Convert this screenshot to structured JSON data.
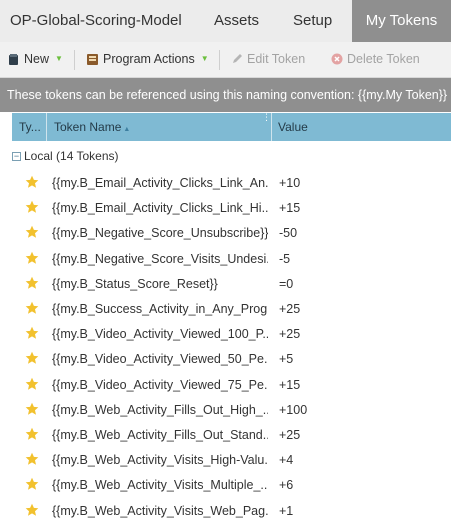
{
  "tabs": {
    "title": "OP-Global-Scoring-Model",
    "assets": "Assets",
    "setup": "Setup",
    "my_tokens": "My Tokens"
  },
  "toolbar": {
    "new_label": "New",
    "program_actions_label": "Program Actions",
    "edit_token_label": "Edit Token",
    "delete_token_label": "Delete Token"
  },
  "notice": "These tokens can be referenced using this naming convention: {{my.My Token}}",
  "grid": {
    "columns": {
      "type": "Ty...",
      "token_name": "Token Name",
      "value": "Value"
    },
    "group_label": "Local (14 Tokens)",
    "rows": [
      {
        "name": "{{my.B_Email_Activity_Clicks_Link_An...",
        "value": "+10"
      },
      {
        "name": "{{my.B_Email_Activity_Clicks_Link_Hi...",
        "value": "+15"
      },
      {
        "name": "{{my.B_Negative_Score_Unsubscribe}}",
        "value": "-50"
      },
      {
        "name": "{{my.B_Negative_Score_Visits_Undesi...",
        "value": "-5"
      },
      {
        "name": "{{my.B_Status_Score_Reset}}",
        "value": "=0"
      },
      {
        "name": "{{my.B_Success_Activity_in_Any_Prog...",
        "value": "+25"
      },
      {
        "name": "{{my.B_Video_Activity_Viewed_100_P...",
        "value": "+25"
      },
      {
        "name": "{{my.B_Video_Activity_Viewed_50_Pe...",
        "value": "+5"
      },
      {
        "name": "{{my.B_Video_Activity_Viewed_75_Pe...",
        "value": "+15"
      },
      {
        "name": "{{my.B_Web_Activity_Fills_Out_High_...",
        "value": "+100"
      },
      {
        "name": "{{my.B_Web_Activity_Fills_Out_Stand...",
        "value": "+25"
      },
      {
        "name": "{{my.B_Web_Activity_Visits_High-Valu...",
        "value": "+4"
      },
      {
        "name": "{{my.B_Web_Activity_Visits_Multiple_...",
        "value": "+6"
      },
      {
        "name": "{{my.B_Web_Activity_Visits_Web_Pag...",
        "value": "+1"
      }
    ]
  },
  "colors": {
    "header_blue": "#7fbad3",
    "star": "#f2c12e",
    "active_tab": "#8f8f8f"
  }
}
